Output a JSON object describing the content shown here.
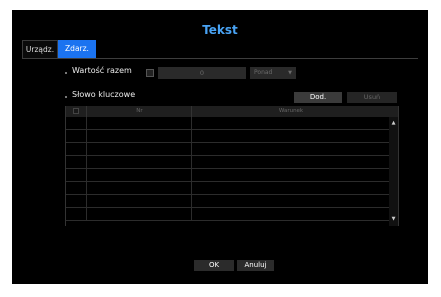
{
  "dialog": {
    "title": "Tekst"
  },
  "tabs": [
    {
      "label": "Urządz.",
      "active": false
    },
    {
      "label": "Zdarz.",
      "active": true
    }
  ],
  "total_value": {
    "label": "Wartość razem",
    "checked": false,
    "value": "0",
    "operator": "Ponad"
  },
  "keywords": {
    "label": "Słowo kluczowe",
    "add_label": "Dod.",
    "delete_label": "Usuń",
    "columns": {
      "nr": "Nr",
      "condition": "Warunek"
    },
    "row_count": 8
  },
  "footer": {
    "ok_label": "OK",
    "cancel_label": "Anuluj"
  },
  "colors": {
    "accent": "#1b73f0",
    "title": "#49a3f4",
    "background": "#000000"
  },
  "icons": {
    "scroll_up": "triangle-up",
    "scroll_down": "triangle-down",
    "select_caret": "triangle-down"
  }
}
